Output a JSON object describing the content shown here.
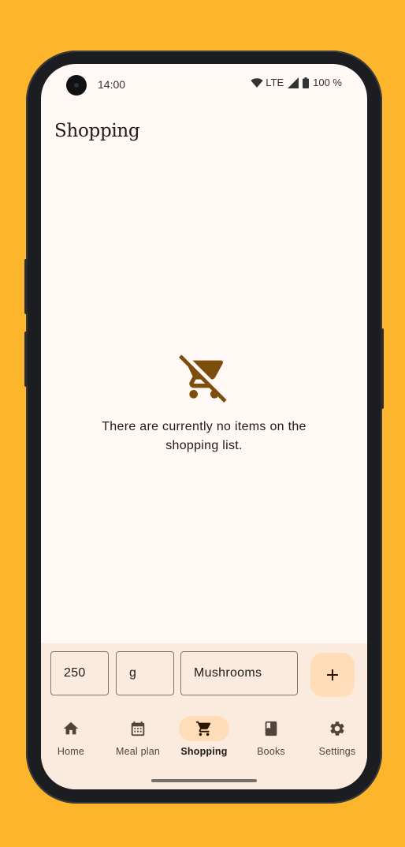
{
  "status_bar": {
    "time": "14:00",
    "network": "LTE",
    "battery": "100 %",
    "icons": [
      "camera-icon",
      "wifi-icon",
      "signal-icon",
      "battery-icon"
    ]
  },
  "header": {
    "title": "Shopping"
  },
  "empty_state": {
    "icon": "cart-off-icon",
    "message": "There are currently no items on the shopping list."
  },
  "input_bar": {
    "quantity": "250",
    "unit": "g",
    "item": "Mushrooms",
    "add_icon": "plus-icon"
  },
  "nav": {
    "items": [
      {
        "label": "Home",
        "icon": "home-icon",
        "active": false
      },
      {
        "label": "Meal plan",
        "icon": "calendar-icon",
        "active": false
      },
      {
        "label": "Shopping",
        "icon": "cart-icon",
        "active": true
      },
      {
        "label": "Books",
        "icon": "book-icon",
        "active": false
      },
      {
        "label": "Settings",
        "icon": "gear-icon",
        "active": false
      }
    ]
  },
  "colors": {
    "background": "#FDB52C",
    "screen": "#FFF8F4",
    "accent_container": "#FFDDB8",
    "icon_brown": "#7C4E0D"
  }
}
